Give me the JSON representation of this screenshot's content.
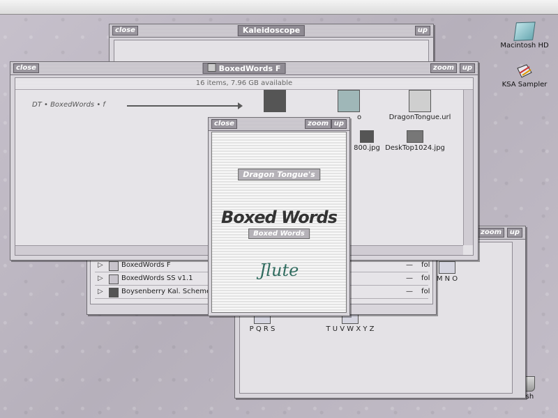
{
  "desktop": {
    "icons": [
      {
        "label": "Macintosh HD"
      },
      {
        "label": "KSA Sampler"
      },
      {
        "label": "Trash"
      }
    ]
  },
  "windows": {
    "kaleidoscope": {
      "title": "Kaleidoscope",
      "close": "close",
      "up": "up"
    },
    "boxedwords": {
      "title": "BoxedWords F",
      "close": "close",
      "zoom": "zoom",
      "up": "up",
      "info": "16 items, 7.96 GB available",
      "path_label": "DT • BoxedWords • f",
      "items": [
        {
          "label": "o"
        },
        {
          "label": "DragonTongue.url"
        },
        {
          "label": "800.jpg"
        },
        {
          "label": "DeskTop1024.jpg"
        }
      ]
    },
    "list": {
      "rows": [
        {
          "name": "BoxedWords F",
          "dash": "—",
          "kind": "fol"
        },
        {
          "name": "BoxedWords SS v1.1",
          "dash": "—",
          "kind": "fol"
        },
        {
          "name": "Boysenberry Kal. Scheme",
          "dash": "—",
          "kind": "fol"
        }
      ]
    },
    "letters": {
      "zoom": "zoom",
      "up": "up",
      "folders": [
        {
          "label": "M N O"
        },
        {
          "label": "P Q R S"
        },
        {
          "label": "T U V W X Y Z"
        }
      ]
    },
    "about": {
      "close": "close",
      "zoom": "zoom",
      "up": "up",
      "top_label": "Dragon Tongue's",
      "title": "Boxed Words",
      "sub_label": "Boxed Words",
      "signature": "Jlute"
    }
  },
  "colors": {
    "desktop": "#bdb7c2",
    "window": "#d9d6dc",
    "title_button": "#9a969e",
    "signature": "#2f6b5e"
  }
}
